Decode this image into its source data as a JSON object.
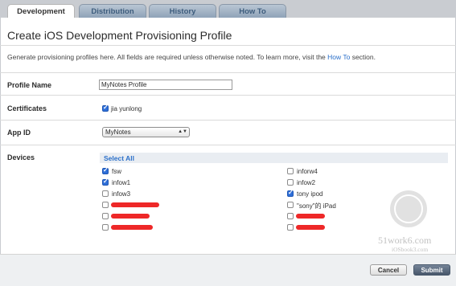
{
  "tabs": [
    "Development",
    "Distribution",
    "History",
    "How To"
  ],
  "active_tab": "Development",
  "page_title": "Create iOS Development Provisioning Profile",
  "intro": {
    "text_before": "Generate provisioning profiles here. All fields are required unless otherwise noted. To learn more, visit the ",
    "link": "How To",
    "text_after": " section."
  },
  "fields": {
    "profile_name_label": "Profile Name",
    "profile_name_value": "MyNotes Profile",
    "certificates_label": "Certificates",
    "certificate_name": "jia yunlong",
    "app_id_label": "App ID",
    "app_id_value": "MyNotes",
    "devices_label": "Devices"
  },
  "devices": {
    "select_all": "Select All",
    "left_column": [
      {
        "name": "fsw",
        "checked": true
      },
      {
        "name": "infow1",
        "checked": true
      },
      {
        "name": "infow3",
        "checked": false
      }
    ],
    "right_column": [
      {
        "name": "inforw4",
        "checked": false
      },
      {
        "name": "infow2",
        "checked": false
      },
      {
        "name": "tony ipod",
        "checked": true
      },
      {
        "name": "\"sony\"的 iPad",
        "checked": false
      }
    ]
  },
  "buttons": {
    "cancel": "Cancel",
    "submit": "Submit"
  },
  "watermark": {
    "line1": "51work6.com",
    "line2": "iOSbook3.com"
  },
  "colors": {
    "link": "#2a6fc9",
    "checkbox_checked": "#2f6fd8",
    "redaction": "#ee2828"
  }
}
